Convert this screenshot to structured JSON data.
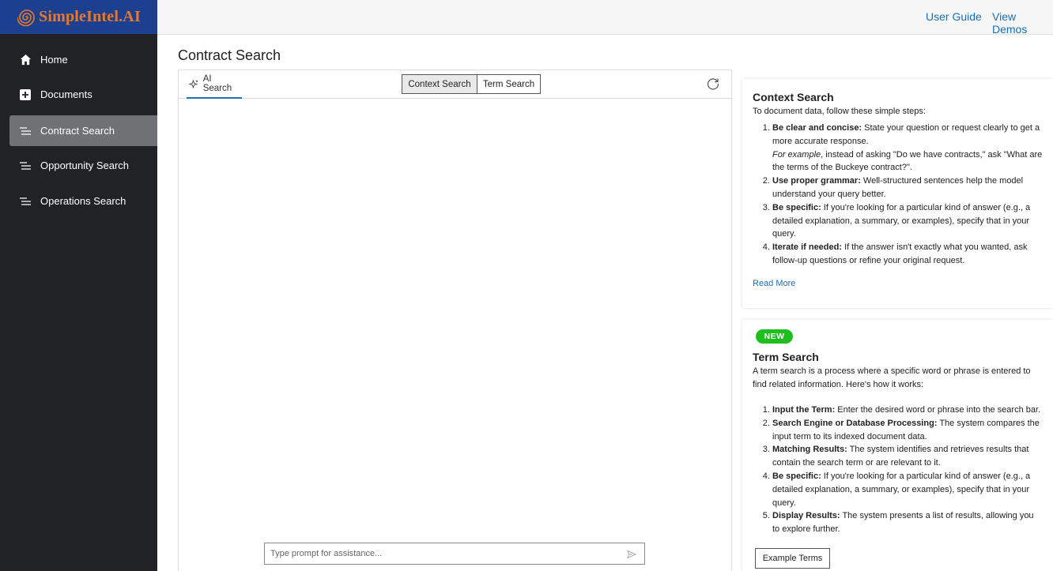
{
  "brand": {
    "name": "SimpleIntel.AI",
    "color": "#e8792c",
    "bar_color": "#1d3f8f"
  },
  "sidebar": {
    "items": [
      {
        "label": "Home",
        "icon": "home-icon",
        "active": false
      },
      {
        "label": "Documents",
        "icon": "plus-square-icon",
        "active": false
      },
      {
        "label": "Contract Search",
        "icon": "list-lines-icon",
        "active": true
      },
      {
        "label": "Opportunity Search",
        "icon": "list-lines-icon",
        "active": false
      },
      {
        "label": "Operations Search",
        "icon": "list-lines-icon",
        "active": false
      }
    ]
  },
  "topbar": {
    "user_guide": "User Guide",
    "view_demos": "View Demos"
  },
  "page": {
    "title": "Contract Search"
  },
  "search_panel": {
    "ai_tab": "AI Search",
    "segments": [
      "Context Search",
      "Term Search"
    ],
    "selected_segment": "Context Search",
    "prompt_placeholder": "Type prompt for assistance..."
  },
  "context_card": {
    "title": "Context Search",
    "intro": "To document data, follow these simple steps:",
    "steps": [
      {
        "bold": "Be clear and concise:",
        "text": " State your question or request clearly to get a more accurate response.",
        "example_em": "For example",
        "example_text": ", instead of asking \"Do we have contracts,\" ask \"What are the terms of the Buckeye contract?\"."
      },
      {
        "bold": "Use proper grammar:",
        "text": " Well-structured sentences help the model understand your query better."
      },
      {
        "bold": "Be specific:",
        "text": " If you're looking for a particular kind of answer (e.g., a detailed explanation, a summary, or examples), specify that in your query."
      },
      {
        "bold": "Iterate if needed:",
        "text": " If the answer isn't exactly what you wanted, ask follow-up questions or refine your original request."
      }
    ],
    "read_more": "Read More"
  },
  "term_card": {
    "badge": "NEW",
    "title": "Term Search",
    "intro": "A term search is a process where a specific word or phrase is entered to find related information. Here's how it works:",
    "steps": [
      {
        "bold": "Input the Term:",
        "text": " Enter the desired word or phrase into the search bar."
      },
      {
        "bold": "Search Engine or Database Processing:",
        "text": " The system compares the input term to its indexed document data."
      },
      {
        "bold": "Matching Results:",
        "text": " The system identifies and retrieves results that contain the search term or are relevant to it."
      },
      {
        "bold": "Be specific:",
        "text": " If you're looking for a particular kind of answer (e.g., a detailed explanation, a summary, or examples), specify that in your query."
      },
      {
        "bold": "Display Results:",
        "text": " The system presents a list of results, allowing you to explore further."
      }
    ],
    "button": "Example Terms"
  }
}
